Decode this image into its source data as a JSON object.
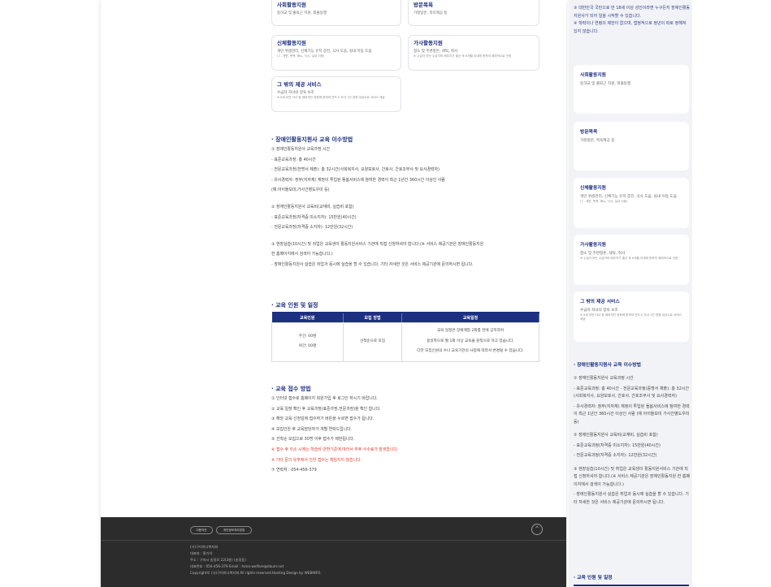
{
  "services": [
    {
      "title": "사회활동지원",
      "desc": "등하교 및 출퇴근 지원, 외출동행",
      "note": ""
    },
    {
      "title": "방문목욕",
      "desc": "가정방문, 목욕제공 등",
      "note": ""
    },
    {
      "title": "신체활동지원",
      "desc": "개인 위생관리, 신체기능 유지 증진, 식사 도움, 실내 이동 도움",
      "note": "(ㄷ. 세면, 목욕, 배뇨, 식사, 실내 이동)"
    },
    {
      "title": "가사활동지원",
      "desc": "청소 및 주변정돈, 세탁, 취사",
      "note": "※ 수급자 또는 수급자의 배우자가 출산 후 6개월 이내에 한하여 예외적으로 인정"
    },
    {
      "title": "그 밖의 제공 서비스",
      "desc": "수급자 자녀의 양육 보조",
      "note": "※ 6세 미만 자녀 등 예외적인 양육에 한하여 반드시 자녀 1인 양육 대상으로 서비스 제공"
    }
  ],
  "sections": {
    "training": {
      "title": "· 장애인활동지원사 교육 이수방법",
      "lines": [
        {
          "t": "① 장애인활동지원사 교육과정 시간",
          "gap": false,
          "red": false
        },
        {
          "t": "- 표준교육과정: 총 40시간",
          "gap": false,
          "red": false
        },
        {
          "t": "- 전문교육과정(전명서 제출): 총 32시간(사회복지사, 요양보호사, 간호사, 간호조무사 및 요사경력자)",
          "gap": false,
          "red": false
        },
        {
          "t": "- 유사경력자: 정부(지자체) 재정이 투입된 돌봄서비스에 참여한 경력이 최근 1년간 360시간 이상인 사람",
          "gap": false,
          "red": false
        },
        {
          "t": "(예:아이돌보미,가사간병도우미 등)",
          "gap": false,
          "red": false
        },
        {
          "t": "② 장애인활동지원사 교육비(교재비, 실습비 포함)",
          "gap": true,
          "red": false
        },
        {
          "t": "- 표준교육과정(자격증 미소지자): 15만원(40시간)",
          "gap": false,
          "red": false
        },
        {
          "t": "- 전문교육과정(자격증 소지자): 12만원(32시간)",
          "gap": false,
          "red": false
        },
        {
          "t": "③ 현장실습(10시간) 및 취업은 교육생이 활동지원서비스 기관에 직접 신청하셔야 합니다.(※ 서비스 제공기관은 장애인활동지원",
          "gap": true,
          "red": false
        },
        {
          "t": "한 홈페이지에서 검색이 가능합니다.)",
          "gap": false,
          "red": false
        },
        {
          "t": "- 장애인활동지원사 실습은 취업과 동시에 실습을 할 수 있습니다. 기타 자세한 것은 서비스 제공기관에 문의하시면 됩니다.",
          "gap": false,
          "red": false
        }
      ]
    },
    "schedule": {
      "title": "· 교육 인원 및 일정",
      "headers": [
        "교육인원",
        "모집 방법",
        "교육일정"
      ],
      "col1": [
        "주간: 00명",
        "야간: 00명"
      ],
      "col2": "선착순으로 모집",
      "col3": [
        "교육 일정은 장애계정 2회를 전에 공지하며",
        "동일학으로 월 1회 이상 교육을 원칙으로 하고 있습니다.",
        "다만 모집인원의 수나 교육기관의 사정에 따라서 변경될 수 있습니다."
      ]
    },
    "reception": {
      "title": "· 교육 접수 방법",
      "lines": [
        {
          "t": "① 인터넷 접수로 홈페이지 회원가입 후 로그인 하시기 바랍니다.",
          "red": false
        },
        {
          "t": "② 교육 일정 확인 후 교육과정(표준과정,전문과정)을 확인 합니다.",
          "red": false
        },
        {
          "t": "③ 해당 교육 신청일에 접수하기 버튼을 누르면 접수가 됩니다.",
          "red": false
        },
        {
          "t": "④ 모집인원 후 교육담당자가 개별 연락드립니다.",
          "red": false
        },
        {
          "t": "⑤ 선착순 모집으로 30명 이후 접수가 제한됩니다.",
          "red": false
        },
        {
          "t": "⑥ 접수 후 취소 시에는 학습비 반환기준에 따라서 추후 수수료가 발생합니다.",
          "red": true
        },
        {
          "t": "※ 기타 문의 유무에서 인한 접수는 책임지지 않습니다.",
          "red": true
        },
        {
          "t": "⑦ 연락처 : 054-456-379",
          "red": false
        }
      ]
    }
  },
  "footer": {
    "links": [
      "이용약관",
      "개인정보처리방침"
    ],
    "top_label": "^",
    "info": [
      "(사)구미하나복지회",
      "대표자 : 홍기석",
      "주소 : 구미시 송정로 22(3층) (송정동)",
      "대표번호 : 054-456-379  Email : hona-welfare@daum.net",
      "Copyright© (사)구미하나복지회 All rights reserved.Hosting Design by WEBINFO."
    ]
  },
  "mobile": {
    "intro": [
      "③ 대한민국 국민으로 만 18세 이상 성인이라면 누구든지 장애인활동 지원사가 되어 일을 시작할 수 있습니다.",
      "④ 학력이나 연령의 제한이 없으며, 법정적으로 정년이 따로 정해져 있지 않습니다."
    ],
    "cards": [
      {
        "title": "사회활동지원",
        "desc": "등하교 및 출퇴근 지원, 외출동행",
        "note": ""
      },
      {
        "title": "방문목욕",
        "desc": "가정방문, 목욕제공 등",
        "note": ""
      },
      {
        "title": "신체활동지원",
        "desc": "개인 위생관리, 신체기능 유지 증진, 식사 도움, 실내 이동 도움",
        "note": "(ㄷ. 세면, 목욕, 배뇨, 식사, 실내 이동)"
      },
      {
        "title": "가사활동지원",
        "desc": "청소 및 주변정돈, 세탁, 취사",
        "note": "※ 수급자 또는 수급자의 배우자가 출산 후 6개월 이내에 한하여 예외적으로 인정"
      },
      {
        "title": "그 밖의 제공 서비스",
        "desc": "수급자 자녀의 양육 보조",
        "note": "※ 6세 미만 자녀 등 예외적인 양육에 한하여 반드시 자녀 1인 양육 대상으로 서비스 제공"
      }
    ],
    "training_title": "· 장애인활동지원사 교육 이수방법",
    "training_lines": [
      "① 장애인활동지원사 교육과정 시간",
      "- 표준교육과정: 총 40시간 - 전문교육과정(증명서 제출): 총 32시간(사회복지사, 요양보호사, 간호사, 간호조무사 및 요사경력자)",
      "- 유사경력자: 정부(지자체) 재정이 투입된 돌봄서비스에 참여한 경력이 최근 1년간 360시간 이상인 사람 (예 아이돌보미 가사간병도우미 등)",
      "② 장애인활동지원사 교육비(교재비, 실습비 포함)",
      "- 표준교육과정(자격증 미소지자): 15만원(40시간)",
      "- 전문교육과정(자격증 소지자): 12만원(32시간)",
      "③ 현장실습(10시간) 및 취업은 교육생이 활동지원서비스 기관에 직접 신청하셔야 합니다.(※ 서비스 제공기관은 장애인활동지원 한 홈페이지에서 검색이 가능합니다.)",
      "- 장애인활동지원사 실습은 취업과 동시에 실습을 할 수 있습니다. 기타 자세한 것은 서비스 제공기관에 문의하시면 됩니다."
    ],
    "schedule_title": "· 교육 인원 및 일정"
  }
}
